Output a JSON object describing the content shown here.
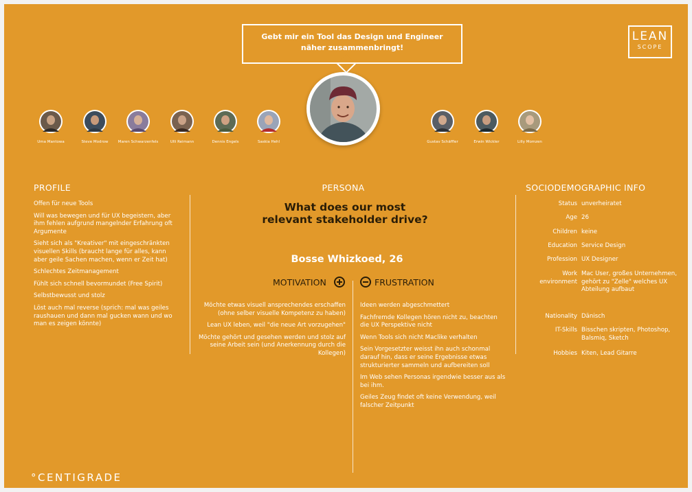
{
  "bubble": {
    "text": "Gebt mir ein Tool das Design und Engineer näher zusammenbringt!"
  },
  "logo": {
    "line1": "LEAN",
    "line2": "SCOPE"
  },
  "stakeholders_left": [
    {
      "name": "Uma Mantowa"
    },
    {
      "name": "Steve Modrow"
    },
    {
      "name": "Maren Schwarzenfels"
    },
    {
      "name": "Ulli Reimann"
    },
    {
      "name": "Dennis Engels"
    },
    {
      "name": "Saskia Hehl"
    }
  ],
  "stakeholders_right": [
    {
      "name": "Gustav Schäffler"
    },
    {
      "name": "Erwin Wickler"
    },
    {
      "name": "Lilly Momzen"
    }
  ],
  "profile": {
    "heading": "PROFILE",
    "items": [
      "Offen für neue Tools",
      "Will was bewegen und für UX begeistern, aber ihm fehlen aufgrund mangelnder Erfahrung oft Argumente",
      "Sieht sich als \"Kreativer\" mit eingeschränkten visuellen Skills (braucht lange für alles, kann aber geile Sachen machen, wenn er Zeit hat)",
      "Schlechtes Zeitmanagement",
      "Fühlt sich schnell bevormundet (Free Spirit)",
      "Selbstbewusst und stolz",
      "Löst auch mal reverse (sprich: mal was geiles raushauen und dann mal gucken wann und wo man es zeigen könnte)"
    ]
  },
  "persona": {
    "heading": "PERSONA",
    "question": "What does our most relevant stakeholder drive?",
    "name": "Bosse Whizkoed, 26",
    "motivation_label": "MOTIVATION",
    "frustration_label": "FRUSTRATION",
    "motivation": [
      "Möchte etwas visuell ansprechendes erschaffen (ohne selber visuelle Kompetenz zu haben)",
      "Lean UX leben, weil \"die neue Art vorzugehen\"",
      "Möchte gehört und gesehen werden und stolz auf seine Arbeit sein (und Anerkennung durch die Kollegen)"
    ],
    "frustration": [
      "Ideen werden abgeschmettert",
      "Fachfremde Kollegen hören nicht zu, beachten die UX Perspektive nicht",
      "Wenn Tools sich nicht Maclike verhalten",
      "Sein Vorgesetzter weisst ihn auch schonmal darauf hin, dass er seine Ergebnisse etwas strukturierter sammeln und aufbereiten soll",
      "Im Web sehen Personas irgendwie besser aus als bei ihm.",
      "Geiles Zeug findet oft keine Verwendung, weil falscher Zeitpunkt"
    ]
  },
  "socio": {
    "heading": "SOCIODEMOGRAPHIC INFO",
    "rows": [
      {
        "key": "Status",
        "value": "unverheiratet"
      },
      {
        "key": "Age",
        "value": "26"
      },
      {
        "key": "Children",
        "value": "keine"
      },
      {
        "key": "Education",
        "value": "Service Design"
      },
      {
        "key": "Profession",
        "value": "UX Designer"
      },
      {
        "key": "Work environment",
        "value": "Mac User, großes Unternehmen, gehört zu \"Zelle\" welches UX Abteilung aufbaut"
      },
      {
        "key": "Nationality",
        "value": "Dänisch"
      },
      {
        "key": "IT-Skills",
        "value": "Bisschen skripten, Photoshop, Balsmiq, Sketch"
      },
      {
        "key": "Hobbies",
        "value": "Kiten, Lead Gitarre"
      }
    ]
  },
  "footer": {
    "brand": "°CENTIGRADE"
  },
  "colors": {
    "background": "#e2992a",
    "text_dark": "#2a1d07",
    "text_light": "#ffffff"
  }
}
